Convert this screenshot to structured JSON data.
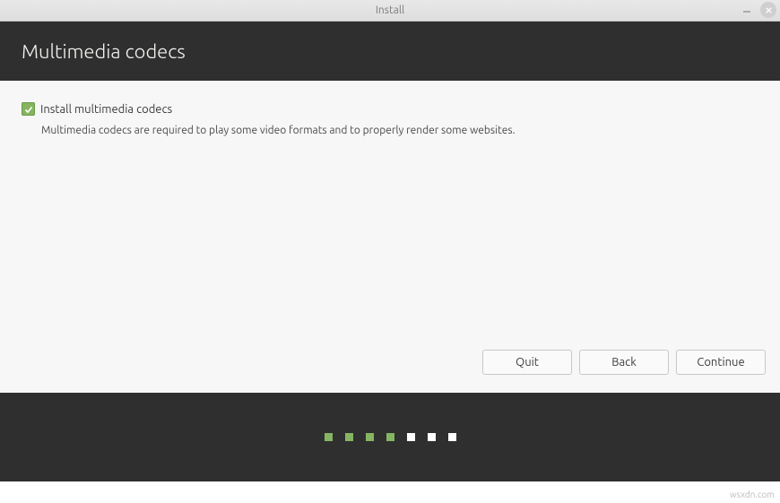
{
  "window": {
    "title": "Install"
  },
  "header": {
    "title": "Multimedia codecs"
  },
  "content": {
    "checkbox_label": "Install multimedia codecs",
    "checkbox_checked": true,
    "description": "Multimedia codecs are required to play some video formats and to properly render some websites."
  },
  "buttons": {
    "quit": "Quit",
    "back": "Back",
    "continue": "Continue"
  },
  "progress": {
    "total": 7,
    "current": 5
  },
  "watermark": "wsxdn.com"
}
